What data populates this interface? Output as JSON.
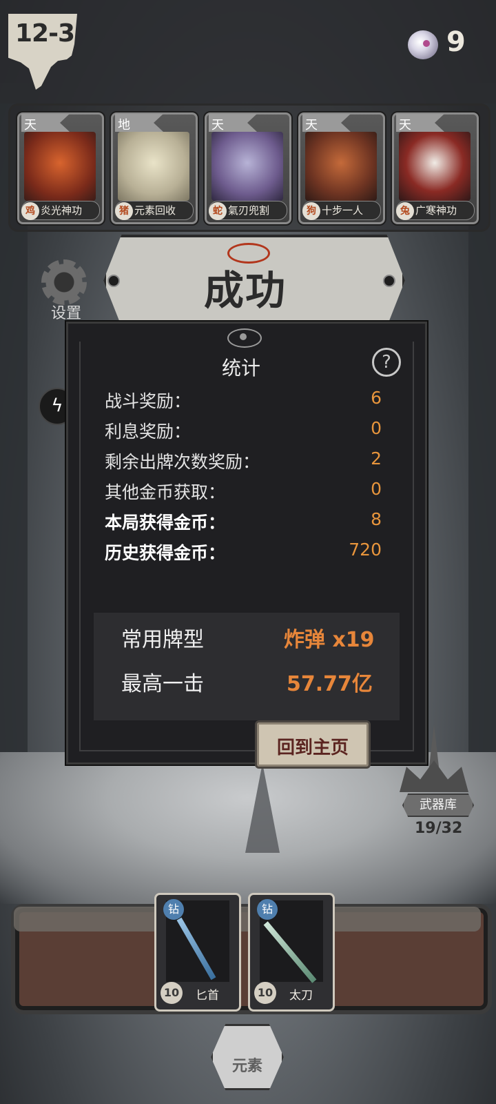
{
  "hud": {
    "level": "12-3",
    "gem_count": "9"
  },
  "team_cards": [
    {
      "tier": "天",
      "zodiac": "鸡",
      "name": "炎光神功"
    },
    {
      "tier": "地",
      "zodiac": "猪",
      "name": "元素回收"
    },
    {
      "tier": "天",
      "zodiac": "蛇",
      "name": "氣刃兜割"
    },
    {
      "tier": "天",
      "zodiac": "狗",
      "name": "十步一人"
    },
    {
      "tier": "天",
      "zodiac": "兔",
      "name": "广寒神功"
    }
  ],
  "banner": {
    "title": "成功"
  },
  "settings": {
    "label": "设置"
  },
  "stats": {
    "title": "统计",
    "rows": [
      {
        "label": "战斗奖励：",
        "value": "6"
      },
      {
        "label": "利息奖励：",
        "value": "0"
      },
      {
        "label": "剩余出牌次数奖励：",
        "value": "2"
      },
      {
        "label": "其他金币获取：",
        "value": "0"
      },
      {
        "label": "本局获得金币：",
        "value": "8"
      },
      {
        "label": "历史获得金币：",
        "value": "720"
      }
    ],
    "summary": {
      "common_hand_label": "常用牌型",
      "common_hand_value": "炸弹 x19",
      "best_hit_label": "最高一击",
      "best_hit_value": "57.77亿"
    },
    "home_button": "回到主页"
  },
  "weapon_library": {
    "label": "武器库",
    "count": "19/32"
  },
  "weapons": [
    {
      "badge": "钻",
      "level": "10",
      "name": "匕首"
    },
    {
      "badge": "钻",
      "level": "10",
      "name": "太刀"
    }
  ],
  "element_button": {
    "label": "元素"
  },
  "colors": {
    "accent_orange": "#e8953c",
    "banner_red": "#b2361c"
  }
}
